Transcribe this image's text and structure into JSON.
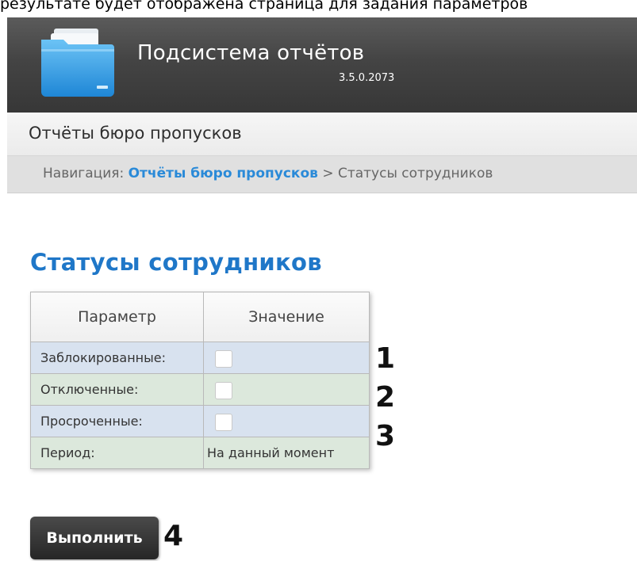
{
  "top_caption": "результате будет отображена страница для задания параметров",
  "header": {
    "app_title": "Подсистема отчётов",
    "version": "3.5.0.2073",
    "logo_icon": "folder-icon"
  },
  "menu": {
    "title": "Отчёты бюро пропусков"
  },
  "breadcrumb": {
    "prefix": "Навигация:",
    "link": "Отчёты бюро пропусков",
    "separator": ">",
    "current": "Статусы сотрудников"
  },
  "page_title": "Статусы сотрудников",
  "table": {
    "headers": [
      "Параметр",
      "Значение"
    ],
    "rows": [
      {
        "label": "Заблокированные:",
        "checked": false
      },
      {
        "label": "Отключенные:",
        "checked": false
      },
      {
        "label": "Просроченные:",
        "checked": false
      },
      {
        "label": "Период:",
        "value": "На данный момент"
      }
    ]
  },
  "markers": [
    "1",
    "2",
    "3",
    "4"
  ],
  "run_button_label": "Выполнить",
  "colors": {
    "accent_blue": "#1f77c8",
    "link_blue": "#2a8ad8",
    "header_dark": "#444444",
    "row_blue": "#d8e2ef",
    "row_green": "#dce8dc"
  }
}
